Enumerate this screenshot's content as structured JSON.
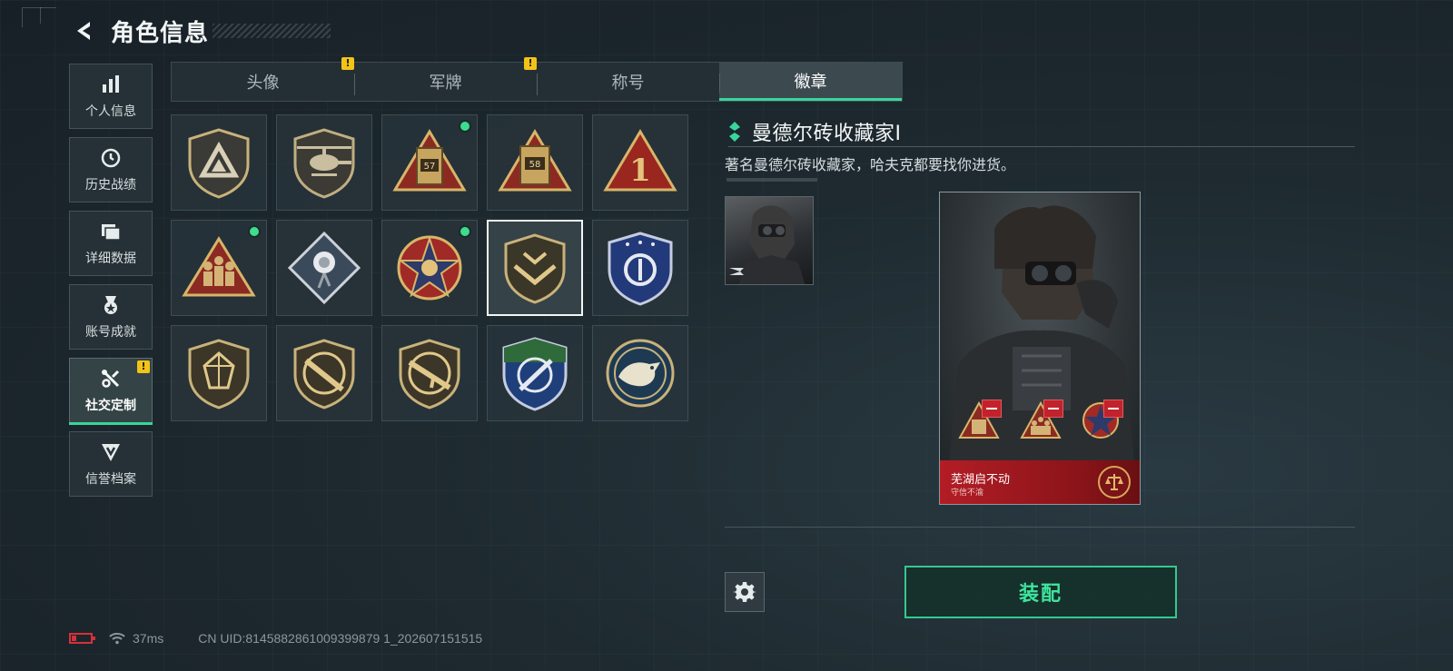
{
  "header": {
    "title": "角色信息"
  },
  "sidebar": {
    "items": [
      {
        "label": "个人信息",
        "icon": "bar-chart-icon",
        "active": false,
        "alert": false
      },
      {
        "label": "历史战绩",
        "icon": "history-clock-icon",
        "active": false,
        "alert": false
      },
      {
        "label": "详细数据",
        "icon": "folder-icon",
        "active": false,
        "alert": false
      },
      {
        "label": "账号成就",
        "icon": "medal-icon",
        "active": false,
        "alert": false
      },
      {
        "label": "社交定制",
        "icon": "tools-icon",
        "active": true,
        "alert": true
      },
      {
        "label": "信誉档案",
        "icon": "reputation-icon",
        "active": false,
        "alert": false
      }
    ],
    "alert_glyph": "!"
  },
  "tabs": [
    {
      "label": "头像",
      "active": false,
      "alert": true
    },
    {
      "label": "军牌",
      "active": false,
      "alert": true
    },
    {
      "label": "称号",
      "active": false,
      "alert": false
    },
    {
      "label": "徽章",
      "active": true,
      "alert": false
    }
  ],
  "badges": [
    {
      "name": "triangle-shield-badge",
      "new": false,
      "selected": false
    },
    {
      "name": "helicopter-badge",
      "new": false,
      "selected": false
    },
    {
      "name": "tower-57-badge",
      "number": "57",
      "new": true,
      "selected": false
    },
    {
      "name": "tower-58-badge",
      "number": "58",
      "new": false,
      "selected": false
    },
    {
      "name": "number-one-triangle-badge",
      "number": "1",
      "new": false,
      "selected": false
    },
    {
      "name": "soldiers-triangle-badge",
      "new": true,
      "selected": false
    },
    {
      "name": "rose-diamond-badge",
      "new": false,
      "selected": false
    },
    {
      "name": "star-skull-badge",
      "new": true,
      "selected": false
    },
    {
      "name": "chevron-shield-badge",
      "new": false,
      "selected": true
    },
    {
      "name": "blue-shield-badge",
      "new": false,
      "selected": false
    },
    {
      "name": "gem-shield-badge",
      "new": false,
      "selected": false
    },
    {
      "name": "rifle-shield-badge",
      "new": false,
      "selected": false
    },
    {
      "name": "rifle-shield-badge-2",
      "new": false,
      "selected": false
    },
    {
      "name": "knife-crosshair-badge",
      "new": false,
      "selected": false
    },
    {
      "name": "eagle-round-badge",
      "new": false,
      "selected": false
    }
  ],
  "detail": {
    "title": "曼德尔砖收藏家Ⅰ",
    "description": "著名曼德尔砖收藏家，哈夫克都要找你进货。"
  },
  "card": {
    "banner_title": "芜湖启不动",
    "banner_subtitle": "守信不渝"
  },
  "actions": {
    "equip_label": "装配"
  },
  "status": {
    "ping": "37ms",
    "uid": "CN UID:8145882861009399879 1_202607151515"
  },
  "colors": {
    "accent": "#38d69a",
    "alert": "#f2c418",
    "danger": "#c2222b"
  }
}
